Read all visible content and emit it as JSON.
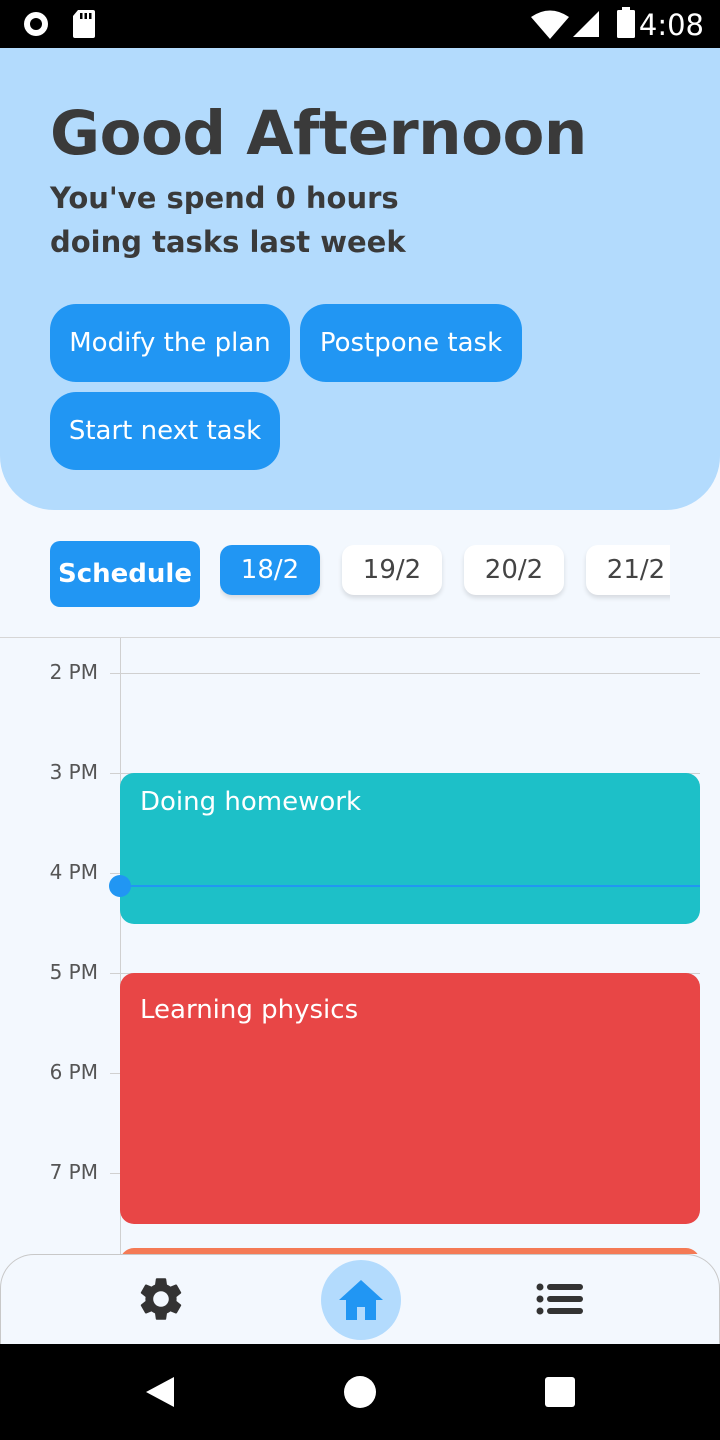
{
  "status_bar": {
    "time": "4:08",
    "icons": [
      "record-icon",
      "sd-card-icon",
      "wifi-icon",
      "signal-icon",
      "battery-icon"
    ]
  },
  "header": {
    "greeting": "Good Afternoon",
    "summary": "You've spend 0 hours doing tasks last week",
    "buttons": {
      "modify": "Modify the plan",
      "postpone": "Postpone task",
      "start": "Start next task"
    }
  },
  "schedule": {
    "label": "Schedule",
    "dates": [
      "18/2",
      "19/2",
      "20/2",
      "21/2"
    ],
    "selected": "18/2"
  },
  "timeline": {
    "hours": [
      "2 PM",
      "3 PM",
      "4 PM",
      "5 PM",
      "6 PM",
      "7 PM"
    ],
    "events": [
      {
        "title": "Doing homework",
        "color": "#1dc0c8"
      },
      {
        "title": "Learning physics",
        "color": "#e84646"
      },
      {
        "title": "",
        "color": "#f47a55"
      }
    ],
    "current_time_indicator_color": "#2196f3"
  },
  "bottom_nav": {
    "items": [
      "settings-icon",
      "home-icon",
      "list-icon"
    ],
    "active": "home-icon"
  },
  "system_nav": {
    "items": [
      "back-icon",
      "home-circle-icon",
      "recents-icon"
    ]
  },
  "colors": {
    "accent": "#2196f3",
    "header_bg": "#b3dbfd",
    "page_bg": "#f3f8fe"
  }
}
